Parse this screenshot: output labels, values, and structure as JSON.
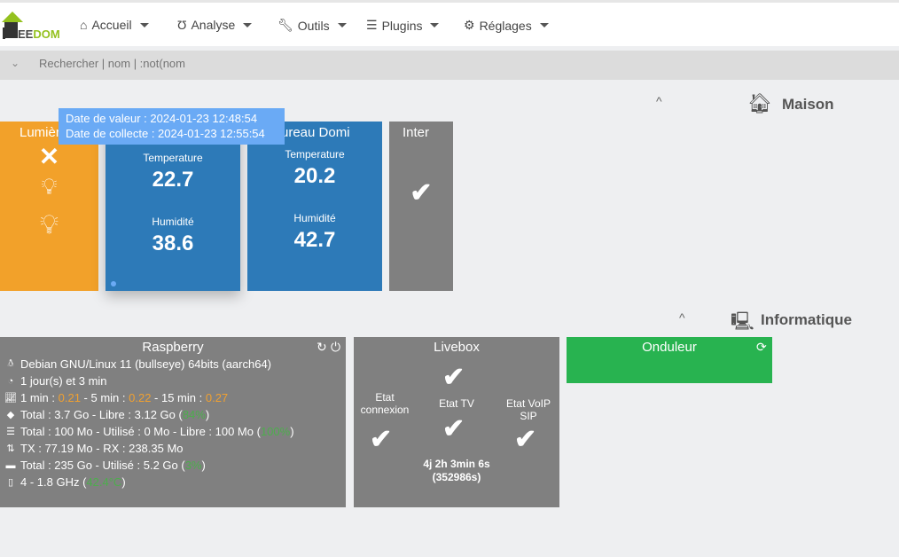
{
  "nav": {
    "logo": "EEDOM",
    "items": [
      {
        "label": "Accueil",
        "icon": "home"
      },
      {
        "label": "Analyse",
        "icon": "stethoscope"
      },
      {
        "label": "Outils",
        "icon": "wrench"
      },
      {
        "label": "Plugins",
        "icon": "list"
      },
      {
        "label": "Réglages",
        "icon": "gear"
      }
    ]
  },
  "search": {
    "placeholder": "Rechercher | nom | :not(nom"
  },
  "groups": {
    "maison": "Maison",
    "informatique": "Informatique"
  },
  "tooltip": {
    "line1": "Date de valeur : 2024-01-23 12:48:54",
    "line2": "Date de collecte : 2024-01-23 12:55:54"
  },
  "tiles": {
    "lumiere": {
      "name": "Lumière"
    },
    "temp1": {
      "l1": "Temperature",
      "v1": "22.7",
      "l2": "Humidité",
      "v2": "38.6"
    },
    "temp2": {
      "name": "Bureau Domi",
      "l1": "Temperature",
      "v1": "20.2",
      "l2": "Humidité",
      "v2": "42.7"
    },
    "inter": {
      "name": "Inter"
    }
  },
  "raspberry": {
    "name": "Raspberry",
    "os": "Debian GNU/Linux 11 (bullseye) 64bits (aarch64)",
    "uptime": "1 jour(s) et 3 min",
    "load": {
      "l1": "1 min : ",
      "v1": "0.21",
      "l5": " - 5 min : ",
      "v5": "0.22",
      "l15": " - 15 min : ",
      "v15": "0.27"
    },
    "mem": {
      "text": "Total : 3.7 Go - Libre : 3.12 Go (",
      "pct": "84%"
    },
    "swap": {
      "text": "Total : 100 Mo - Utilisé : 0 Mo - Libre : 100 Mo (",
      "pct": "100%"
    },
    "net": "TX : 77.19 Mo - RX : 238.35 Mo",
    "disk": {
      "text": "Total : 235 Go - Utilisé : 5.2 Go (",
      "pct": "3%"
    },
    "cpu": {
      "text": "4 - 1.8 GHz (",
      "temp": "42.4°C"
    },
    "close": ")"
  },
  "livebox": {
    "name": "Livebox",
    "etat_connexion": "Etat connexion",
    "etat_tv": "Etat TV",
    "etat_voip": "Etat VoIP SIP",
    "uptime": "4j 2h 3min 6s",
    "uptime_s": "(352986s)"
  },
  "onduleur": {
    "name": "Onduleur"
  }
}
